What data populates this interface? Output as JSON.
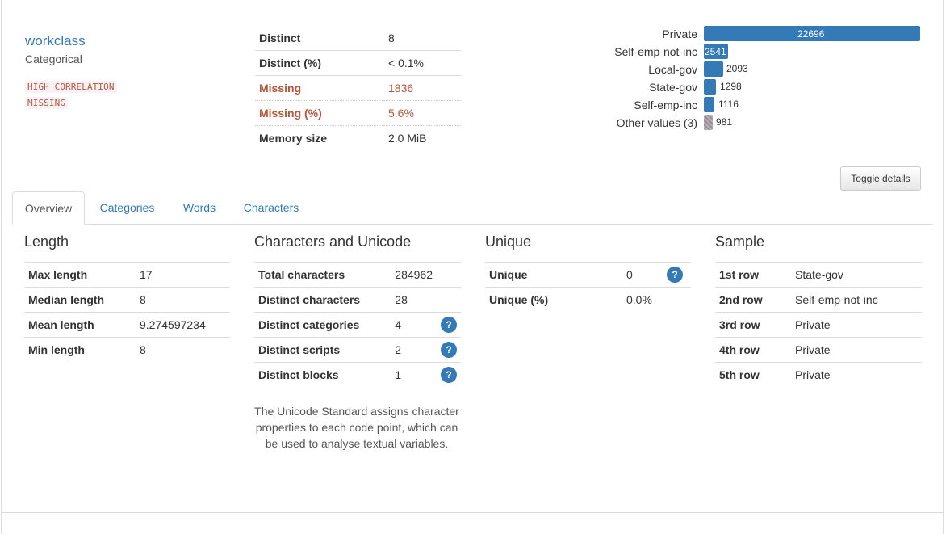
{
  "variable": {
    "name": "workclass",
    "type": "Categorical",
    "alerts": [
      "HIGH CORRELATION",
      "MISSING"
    ]
  },
  "summary": [
    {
      "label": "Distinct",
      "value": "8"
    },
    {
      "label": "Distinct (%)",
      "value": "< 0.1%"
    },
    {
      "label": "Missing",
      "value": "1836"
    },
    {
      "label": "Missing (%)",
      "value": "5.6%"
    },
    {
      "label": "Memory size",
      "value": "2.0 MiB"
    }
  ],
  "frequency_bars": [
    {
      "label": "Private",
      "count": "22696"
    },
    {
      "label": "Self-emp-not-inc",
      "count": "2541"
    },
    {
      "label": "Local-gov",
      "count": "2093"
    },
    {
      "label": "State-gov",
      "count": "1298"
    },
    {
      "label": "Self-emp-inc",
      "count": "1116"
    },
    {
      "label": "Other values (3)",
      "count": "981"
    }
  ],
  "toggle_label": "Toggle details",
  "tabs": [
    "Overview",
    "Categories",
    "Words",
    "Characters"
  ],
  "length": {
    "title": "Length",
    "rows": [
      {
        "label": "Max length",
        "value": "17"
      },
      {
        "label": "Median length",
        "value": "8"
      },
      {
        "label": "Mean length",
        "value": "9.274597234"
      },
      {
        "label": "Min length",
        "value": "8"
      }
    ]
  },
  "unicode": {
    "title": "Characters and Unicode",
    "rows": [
      {
        "label": "Total characters",
        "value": "284962"
      },
      {
        "label": "Distinct characters",
        "value": "28"
      },
      {
        "label": "Distinct categories",
        "value": "4"
      },
      {
        "label": "Distinct scripts",
        "value": "2"
      },
      {
        "label": "Distinct blocks",
        "value": "1"
      }
    ],
    "help_glyph": "?",
    "note": "The Unicode Standard assigns character properties to each code point, which can be used to analyse textual variables."
  },
  "unique": {
    "title": "Unique",
    "rows": [
      {
        "label": "Unique",
        "value": "0"
      },
      {
        "label": "Unique (%)",
        "value": "0.0%"
      }
    ]
  },
  "sample": {
    "title": "Sample",
    "rows": [
      {
        "label": "1st row",
        "value": "State-gov"
      },
      {
        "label": "2nd row",
        "value": "Self-emp-not-inc"
      },
      {
        "label": "3rd row",
        "value": "Private"
      },
      {
        "label": "4th row",
        "value": "Private"
      },
      {
        "label": "5th row",
        "value": "Private"
      }
    ]
  },
  "colors": {
    "accent": "#337ab7",
    "alert": "#b5573b",
    "border": "#dddddd"
  }
}
